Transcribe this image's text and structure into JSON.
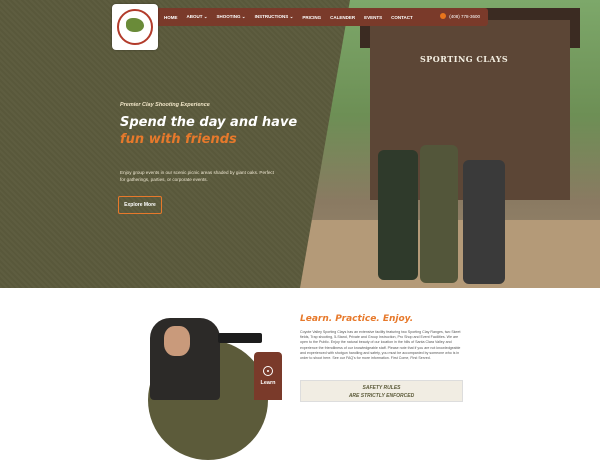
{
  "header": {
    "logo_alt": "Coyote Valley Sporting Clays",
    "nav": [
      "HOME",
      "ABOUT ⌄",
      "SHOOTING ⌄",
      "INSTRUCTIONS ⌄",
      "PRICING",
      "CALENDER",
      "EVENTS",
      "CONTACT"
    ],
    "phone": "(408) 778-3600"
  },
  "hero": {
    "eyebrow": "Premier Clay Shooting Experience",
    "headline_part1": "Spend the day and have",
    "headline_accent": "fun with friends",
    "body": "Enjoy group events in our scenic picnic areas shaded by giant oaks. Perfect for gatherings, parties, or corporate events.",
    "cta": "Explore More",
    "sign": "SPORTING CLAYS"
  },
  "learn_section": {
    "tab_label": "Learn",
    "title": "Learn. Practice. Enjoy.",
    "body": "Coyote Valley Sporting Clays has an extensive facility featuring two Sporting Clay Ranges, two Skeet fields, Trap shooting, 5-Stand, Private and Group Instruction, Pro Shop and Event Facilities. We are open to the Public. Enjoy the natural beauty of our location in the hills of Santa Clara Valley and experience the friendliness of our knowledgeable staff. Please note that if you are not knowledgeable and experienced with shotgun handling and safety, you must be accompanied by someone who is in order to shoot here. See our FAQ's for more information. First Come, First Served.",
    "safety_line1": "SAFETY RULES",
    "safety_line2": "ARE STRICTLY ENFORCED"
  },
  "colors": {
    "nav_bg": "#7a3a2a",
    "accent": "#e7792b",
    "olive": "#5b5a3c"
  }
}
